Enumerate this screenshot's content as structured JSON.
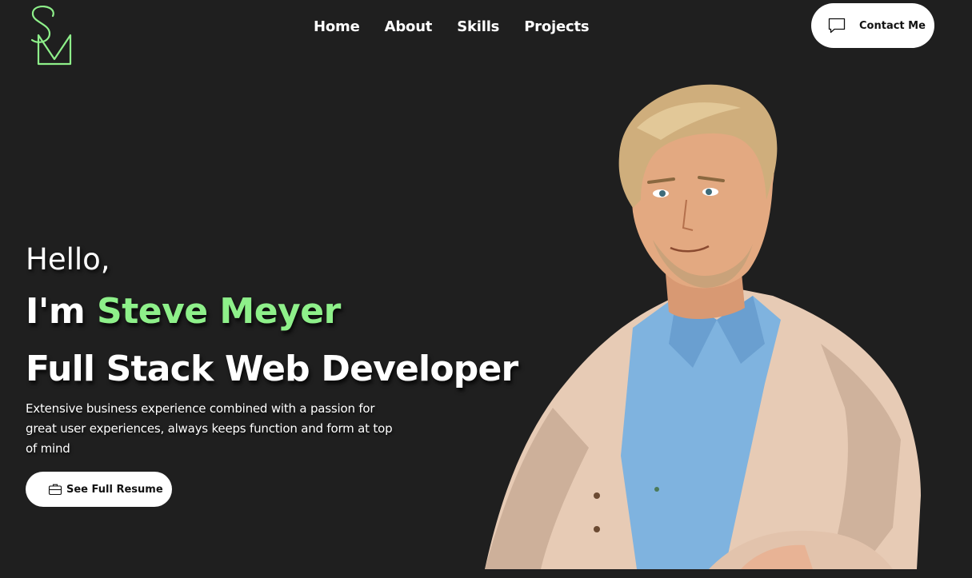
{
  "brand": {
    "logo_icon": "sm-monogram-logo",
    "accent_color": "#8ef08a"
  },
  "nav": {
    "items": [
      {
        "label": "Home"
      },
      {
        "label": "About"
      },
      {
        "label": "Skills"
      },
      {
        "label": "Projects"
      }
    ]
  },
  "contact": {
    "label": "Contact Me",
    "icon": "chat-bubble-icon"
  },
  "hero": {
    "greeting": "Hello,",
    "intro_prefix": "I'm ",
    "name": "Steve Meyer",
    "role": "Full Stack Web Developer",
    "description": "Extensive business experience combined with a passion for great user experiences, always keeps function and form at top of mind",
    "resume_button": {
      "label": "See Full Resume",
      "icon": "briefcase-icon"
    },
    "portrait_icon": "developer-portrait-illustration"
  }
}
